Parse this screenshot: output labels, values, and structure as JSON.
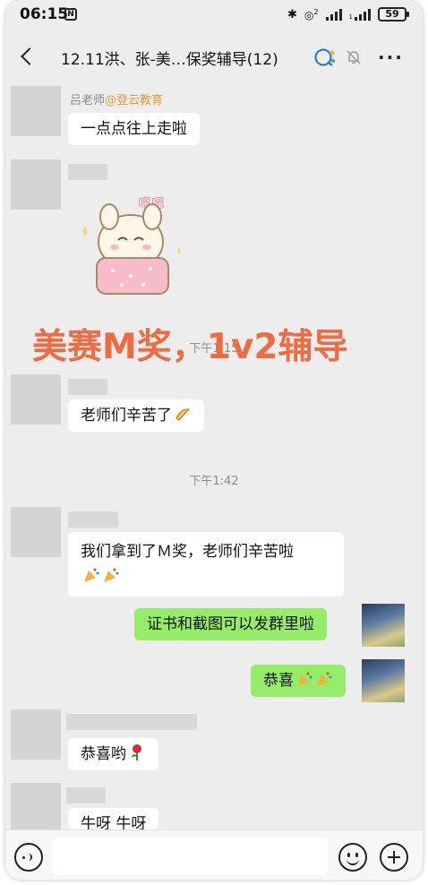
{
  "status_bar": {
    "time": "06:15",
    "nfc": "N",
    "signal_a": "2",
    "signal_b": "1",
    "battery": "59"
  },
  "header": {
    "title": "12.11洪、张-美…保奖辅导(12)"
  },
  "messages": [
    {
      "sender": "吕老师",
      "org": "@登云教育",
      "text": "一点点往上走啦"
    },
    {
      "sticker_text": "嗯嗯"
    },
    {
      "timestamp": "下午1:15"
    },
    {
      "text": "老师们辛苦了"
    },
    {
      "timestamp": "下午1:42"
    },
    {
      "text": "我们拿到了Ｍ奖，老师们辛苦啦"
    },
    {
      "text": "证书和截图可以发群里啦",
      "outgoing": true
    },
    {
      "text": "恭喜",
      "outgoing": true
    },
    {
      "text": "恭喜哟"
    },
    {
      "text": "牛呀 牛呀"
    }
  ],
  "overlay_text": "美赛M奖，1v2辅导",
  "colors": {
    "bubble_out": "#95ec69",
    "overlay": "#ee6b44",
    "org": "#e79a3c"
  }
}
